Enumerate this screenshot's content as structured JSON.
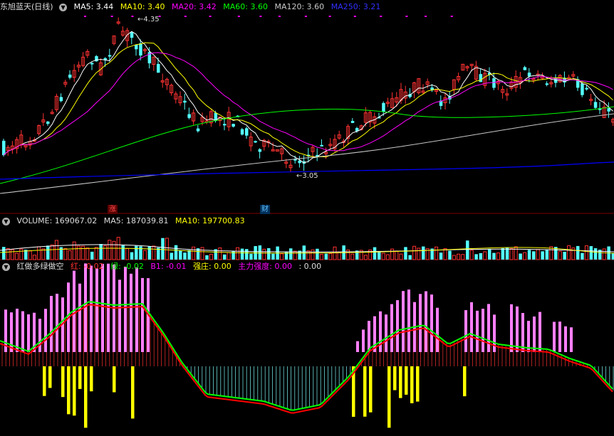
{
  "main": {
    "stock_title": "东旭蓝天(日线)",
    "ma": [
      {
        "label": "MA5: 3.44",
        "color": "#ffffff"
      },
      {
        "label": "MA10: 3.40",
        "color": "#ffff00"
      },
      {
        "label": "MA20: 3.42",
        "color": "#ff00ff"
      },
      {
        "label": "MA60: 3.60",
        "color": "#00ff00"
      },
      {
        "label": "MA120: 3.60",
        "color": "#c8c8c8"
      },
      {
        "label": "MA250: 3.21",
        "color": "#0000ff"
      }
    ],
    "high_label": "4.35",
    "low_label": "3.05",
    "tag_rise": "涨",
    "tag_fin": "财"
  },
  "volume": {
    "label": "VOLUME: 169067.02",
    "ma5": "MA5: 187039.81",
    "ma10": "MA10: 197700.83"
  },
  "indicator": {
    "name": "红做多绿做空",
    "red": "红: -0.02",
    "green": "绿: -0.02",
    "b1": "B1: -0.01",
    "strong": "强庄: 0.00",
    "main_force": "主力强度: 0.00",
    "extra": ": 0.00"
  },
  "colors": {
    "up": "#ff3232",
    "down": "#54ffff",
    "ma5": "#ffffff",
    "ma10": "#ffff00",
    "ma20": "#ff00ff",
    "ma60": "#00ff00",
    "ma120": "#c8c8c8",
    "ma250": "#0000ff",
    "pink": "#ff80ff",
    "yellow": "#ffff00",
    "cyan_bar": "#80ffff",
    "ind_red": "#ff0000",
    "ind_green": "#00ff00",
    "divider": "#800000"
  }
}
